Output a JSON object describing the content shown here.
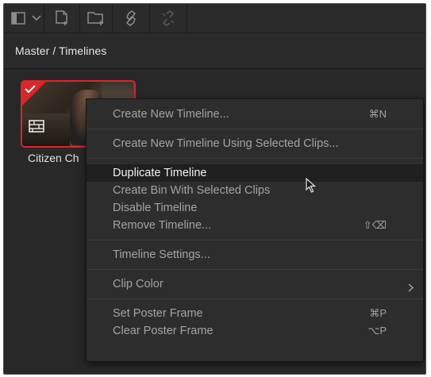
{
  "toolbar": {
    "buttons": [
      {
        "name": "view-toggle",
        "icon": "sidebar-panel-icon"
      },
      {
        "name": "view-menu",
        "icon": "chevron-down-icon"
      },
      {
        "name": "new-clip",
        "icon": "new-document-icon"
      },
      {
        "name": "new-bin",
        "icon": "new-folder-icon"
      },
      {
        "name": "relink",
        "icon": "relink-icon"
      },
      {
        "name": "unlink",
        "icon": "unlink-icon"
      }
    ]
  },
  "breadcrumb": {
    "path": "Master / Timelines"
  },
  "bin": {
    "items": [
      {
        "name": "Citizen Ch",
        "selected": true,
        "type": "timeline"
      }
    ]
  },
  "context_menu": {
    "groups": [
      [
        {
          "label": "Create New Timeline...",
          "shortcut": "⌘N"
        }
      ],
      [
        {
          "label": "Create New Timeline Using Selected Clips..."
        }
      ],
      [
        {
          "label": "Duplicate Timeline",
          "highlighted": true
        },
        {
          "label": "Create Bin With Selected Clips"
        },
        {
          "label": "Disable Timeline"
        },
        {
          "label": "Remove Timeline...",
          "shortcut": "⇧⌫"
        }
      ],
      [
        {
          "label": "Timeline Settings..."
        }
      ],
      [
        {
          "label": "Clip Color",
          "submenu": true
        }
      ],
      [
        {
          "label": "Set Poster Frame",
          "shortcut": "⌘P"
        },
        {
          "label": "Clear Poster Frame",
          "shortcut": "⌥P"
        }
      ]
    ]
  },
  "colors": {
    "panel_bg": "#262626",
    "menu_bg": "#2d2d2d",
    "highlight_bg": "#1f1f1f",
    "selection_red": "#d9262b",
    "text_primary": "#e6e6e6",
    "text_secondary": "#a3a3a3"
  }
}
